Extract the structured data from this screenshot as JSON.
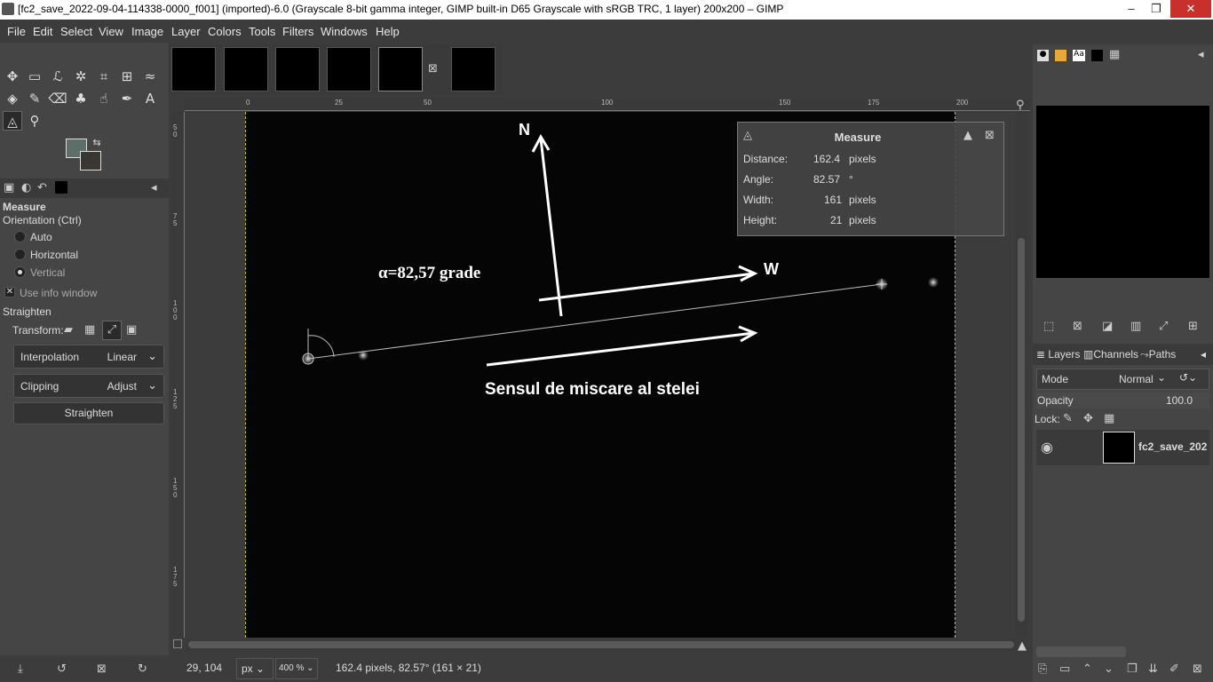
{
  "window": {
    "title": "[fc2_save_2022-09-04-114338-0000_f001] (imported)-6.0 (Grayscale 8-bit gamma integer, GIMP built-in D65 Grayscale with sRGB TRC, 1 layer) 200x200 – GIMP",
    "minimize": "–",
    "maximize": "❐",
    "close": "✕"
  },
  "menubar": [
    "File",
    "Edit",
    "Select",
    "View",
    "Image",
    "Layer",
    "Colors",
    "Tools",
    "Filters",
    "Windows",
    "Help"
  ],
  "tool_options": {
    "title": "Measure",
    "orientation_label": "Orientation  (Ctrl)",
    "orientation_options": [
      "Auto",
      "Horizontal",
      "Vertical"
    ],
    "orientation_selected": "Vertical",
    "use_info_window": "Use info window",
    "straighten_label": "Straighten",
    "transform_label": "Transform:",
    "interpolation_label": "Interpolation",
    "interpolation_value": "Linear",
    "clipping_label": "Clipping",
    "clipping_value": "Adjust",
    "straighten_button": "Straighten"
  },
  "rulers": {
    "h_labels": [
      "0",
      "25",
      "50",
      "100",
      "150",
      "175",
      "200"
    ],
    "v_labels": [
      "5 0",
      "7 5",
      "1 0 0",
      "1 2 5",
      "1 5 0",
      "1 7 5"
    ]
  },
  "annotations": {
    "north": "N",
    "west": "W",
    "angle": "α=82,57 grade",
    "motion": "Sensul de miscare al stelei"
  },
  "measure_dialog": {
    "title": "Measure",
    "rows": [
      {
        "label": "Distance:",
        "value": "162.4",
        "unit": "pixels"
      },
      {
        "label": "Angle:",
        "value": "82.57",
        "unit": "°"
      },
      {
        "label": "Width:",
        "value": "161",
        "unit": "pixels"
      },
      {
        "label": "Height:",
        "value": "21",
        "unit": "pixels"
      }
    ]
  },
  "statusbar": {
    "coords": "29, 104",
    "unit": "px",
    "zoom": "400 %",
    "message": "162.4 pixels, 82.57° (161 × 21)"
  },
  "layers_panel": {
    "tabs": [
      "Layers",
      "Channels",
      "Paths"
    ],
    "mode_label": "Mode",
    "mode_value": "Normal",
    "opacity_label": "Opacity",
    "opacity_value": "100.0",
    "lock_label": "Lock:",
    "layer_name": "fc2_save_202"
  },
  "colors": {
    "fg": "#5e6e68",
    "bg": "#3a3632",
    "guide": "#c8c800",
    "close_btn": "#c8302c"
  }
}
